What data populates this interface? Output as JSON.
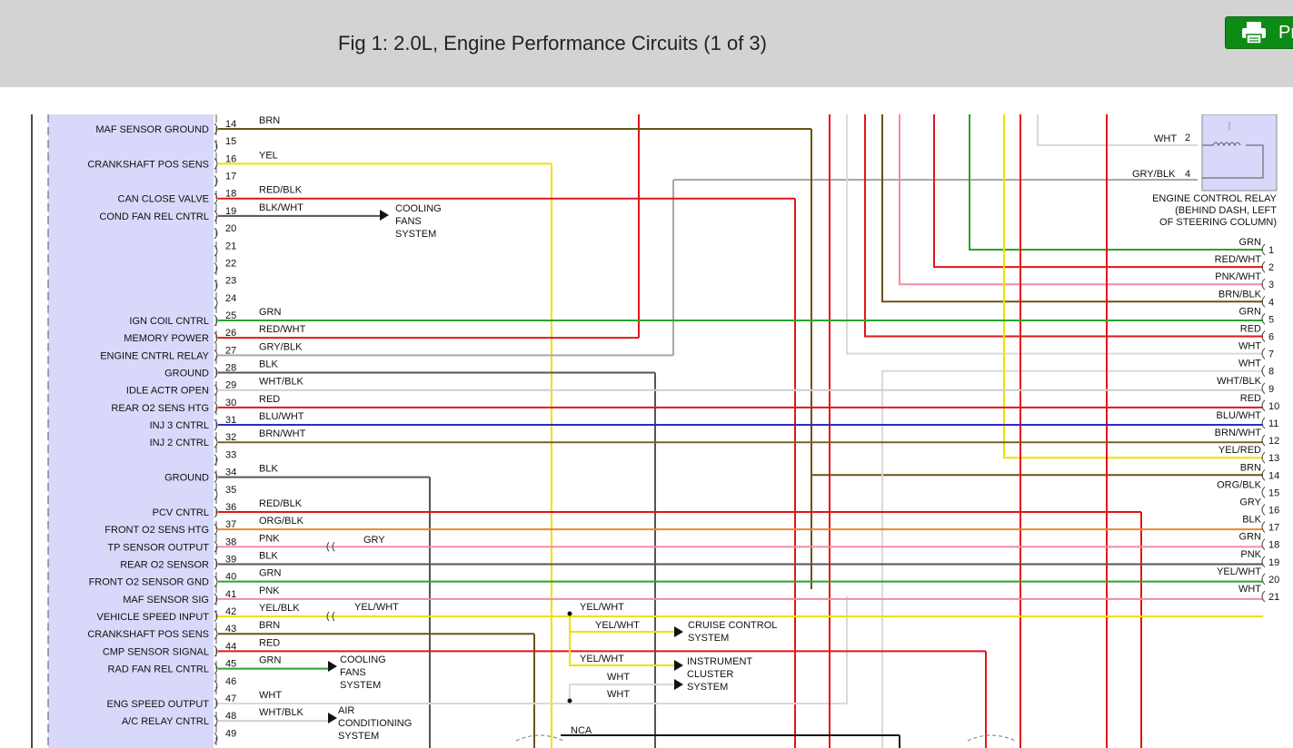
{
  "title": "Fig 1: 2.0L, Engine Performance Circuits (1 of 3)",
  "print_label": "Pr",
  "colors": {
    "BRN": "#6b5317",
    "YEL": "#f0e000",
    "RED": "#e3141b",
    "BLK": "#555555",
    "GRN": "#29a329",
    "GRY": "#b4b4b4",
    "WHT": "#d9d9d9",
    "PNK": "#f08ca0",
    "BLU": "#2a2ac8",
    "ORG": "#e68a2e",
    "BRNWHT": "#7a6228",
    "GRYBLK": "#a8a8a8",
    "BLKWHT": "#555555",
    "WHTBLK": "#cfcfcf",
    "YELBLK": "#f0e000",
    "YELWHT": "#f0e000",
    "REDBLK": "#e3141b",
    "REDWHT": "#e3141b",
    "PNKWHT": "#f08ca0",
    "BRNBLK": "#6b5317",
    "BLUWHT": "#2a2ac8",
    "YELRED": "#f0e000",
    "ORGBLK": "#e68a2e"
  },
  "pins": [
    {
      "num": "14",
      "func": "MAF SENSOR GROUND",
      "wire": "BRN"
    },
    {
      "num": "15",
      "func": "",
      "wire": ""
    },
    {
      "num": "16",
      "func": "CRANKSHAFT POS SENS",
      "wire": "YEL"
    },
    {
      "num": "17",
      "func": "",
      "wire": ""
    },
    {
      "num": "18",
      "func": "CAN CLOSE VALVE",
      "wire": "RED/BLK"
    },
    {
      "num": "19",
      "func": "COND FAN REL CNTRL",
      "wire": "BLK/WHT"
    },
    {
      "num": "20",
      "func": "",
      "wire": ""
    },
    {
      "num": "21",
      "func": "",
      "wire": ""
    },
    {
      "num": "22",
      "func": "",
      "wire": ""
    },
    {
      "num": "23",
      "func": "",
      "wire": ""
    },
    {
      "num": "24",
      "func": "",
      "wire": ""
    },
    {
      "num": "25",
      "func": "IGN COIL CNTRL",
      "wire": "GRN"
    },
    {
      "num": "26",
      "func": "MEMORY POWER",
      "wire": "RED/WHT"
    },
    {
      "num": "27",
      "func": "ENGINE CNTRL RELAY",
      "wire": "GRY/BLK"
    },
    {
      "num": "28",
      "func": "GROUND",
      "wire": "BLK"
    },
    {
      "num": "29",
      "func": "IDLE ACTR OPEN",
      "wire": "WHT/BLK"
    },
    {
      "num": "30",
      "func": "REAR O2 SENS HTG",
      "wire": "RED"
    },
    {
      "num": "31",
      "func": "INJ 3 CNTRL",
      "wire": "BLU/WHT"
    },
    {
      "num": "32",
      "func": "INJ 2 CNTRL",
      "wire": "BRN/WHT"
    },
    {
      "num": "33",
      "func": "",
      "wire": ""
    },
    {
      "num": "34",
      "func": "GROUND",
      "wire": "BLK"
    },
    {
      "num": "35",
      "func": "",
      "wire": ""
    },
    {
      "num": "36",
      "func": "PCV CNTRL",
      "wire": "RED/BLK"
    },
    {
      "num": "37",
      "func": "FRONT O2 SENS HTG",
      "wire": "ORG/BLK"
    },
    {
      "num": "38",
      "func": "TP SENSOR OUTPUT",
      "wire": "PNK"
    },
    {
      "num": "39",
      "func": "REAR O2 SENSOR",
      "wire": "BLK"
    },
    {
      "num": "40",
      "func": "FRONT O2 SENSOR GND",
      "wire": "GRN"
    },
    {
      "num": "41",
      "func": "MAF SENSOR SIG",
      "wire": "PNK"
    },
    {
      "num": "42",
      "func": "VEHICLE SPEED INPUT",
      "wire": "YEL/BLK"
    },
    {
      "num": "43",
      "func": "CRANKSHAFT POS SENS",
      "wire": "BRN"
    },
    {
      "num": "44",
      "func": "CMP SENSOR SIGNAL",
      "wire": "RED"
    },
    {
      "num": "45",
      "func": "RAD FAN REL CNTRL",
      "wire": "GRN"
    },
    {
      "num": "46",
      "func": "",
      "wire": ""
    },
    {
      "num": "47",
      "func": "ENG SPEED OUTPUT",
      "wire": "WHT"
    },
    {
      "num": "48",
      "func": "A/C RELAY CNTRL",
      "wire": "WHT/BLK"
    },
    {
      "num": "49",
      "func": "",
      "wire": ""
    }
  ],
  "right_wires": [
    {
      "num": "1",
      "wire": "GRN"
    },
    {
      "num": "2",
      "wire": "RED/WHT"
    },
    {
      "num": "3",
      "wire": "PNK/WHT"
    },
    {
      "num": "4",
      "wire": "BRN/BLK"
    },
    {
      "num": "5",
      "wire": "GRN"
    },
    {
      "num": "6",
      "wire": "RED"
    },
    {
      "num": "7",
      "wire": "WHT"
    },
    {
      "num": "8",
      "wire": "WHT"
    },
    {
      "num": "9",
      "wire": "WHT/BLK"
    },
    {
      "num": "10",
      "wire": "RED"
    },
    {
      "num": "11",
      "wire": "BLU/WHT"
    },
    {
      "num": "12",
      "wire": "BRN/WHT"
    },
    {
      "num": "13",
      "wire": "YEL/RED"
    },
    {
      "num": "14",
      "wire": "BRN"
    },
    {
      "num": "15",
      "wire": "ORG/BLK"
    },
    {
      "num": "16",
      "wire": "GRY"
    },
    {
      "num": "17",
      "wire": "BLK"
    },
    {
      "num": "18",
      "wire": "GRN"
    },
    {
      "num": "19",
      "wire": "PNK"
    },
    {
      "num": "20",
      "wire": "YEL/WHT"
    },
    {
      "num": "21",
      "wire": "WHT"
    }
  ],
  "relay": {
    "label_lines": [
      "ENGINE CONTROL RELAY",
      "(BEHIND DASH, LEFT",
      "OF STEERING COLUMN)"
    ],
    "pin2_wire": "WHT",
    "pin2_num": "2",
    "pin4_wire": "GRY/BLK",
    "pin4_num": "4"
  },
  "labels": {
    "cooling_fans_1": [
      "COOLING",
      "FANS",
      "SYSTEM"
    ],
    "cooling_fans_2": [
      "COOLING",
      "FANS",
      "SYSTEM"
    ],
    "cruise": [
      "CRUISE CONTROL",
      "SYSTEM"
    ],
    "cluster": [
      "INSTRUMENT",
      "CLUSTER",
      "SYSTEM"
    ],
    "ac": [
      "AIR",
      "CONDITIONING",
      "SYSTEM"
    ],
    "gry_after_conn": "GRY",
    "yelwht_after_conn": "YEL/WHT",
    "yelwht_branch_top": "YEL/WHT",
    "yelwht_branch_cruise": "YEL/WHT",
    "yelwht_branch_cluster": "YEL/WHT",
    "wht_branch_1": "WHT",
    "wht_branch_2": "WHT",
    "nca": "NCA"
  }
}
